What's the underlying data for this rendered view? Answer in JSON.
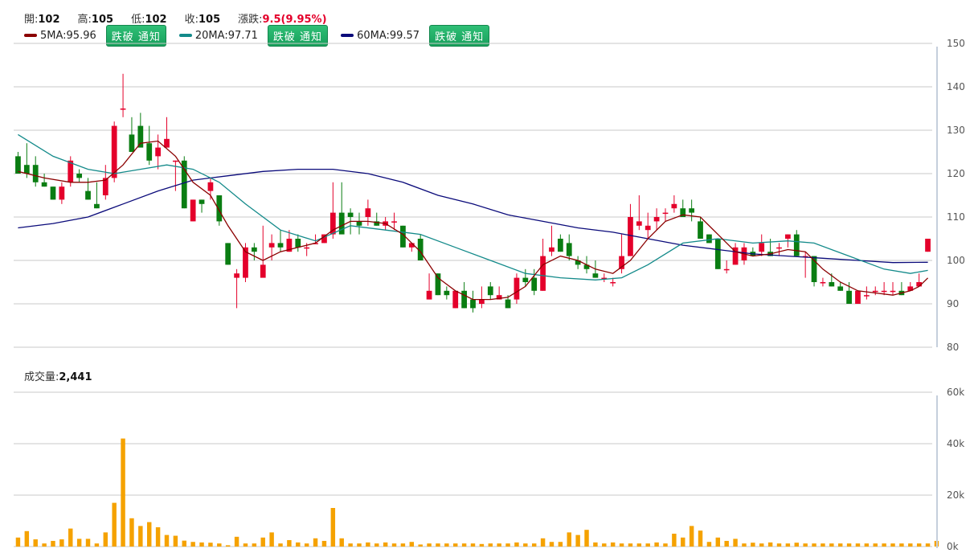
{
  "header": {
    "open_label": "開:",
    "open_value": "102",
    "high_label": "高:",
    "high_value": "105",
    "low_label": "低:",
    "low_value": "102",
    "close_label": "收:",
    "close_value": "105",
    "change_label": "漲跌:",
    "change_value": "9.5(9.95%)"
  },
  "legend": {
    "ma5": "5MA:95.96",
    "ma20": "20MA:97.71",
    "ma60": "60MA:99.57",
    "button_label": "跌破 通知"
  },
  "volume_header": {
    "label": "成交量:",
    "value": "2,441"
  },
  "colors": {
    "up": "#e4002b",
    "down": "#0a7d12",
    "ma5": "#8b0000",
    "ma20": "#138a8a",
    "ma60": "#0a0a7a",
    "volume": "#f5a200",
    "grid": "#c8c8c8"
  },
  "chart_data": [
    {
      "type": "candlestick",
      "ylim": [
        80,
        150
      ],
      "y_ticks": [
        "150",
        "140",
        "130",
        "120",
        "110",
        "100",
        "90",
        "80"
      ],
      "ohlc": [
        [
          124,
          125,
          120,
          120
        ],
        [
          122,
          127,
          119,
          120
        ],
        [
          122,
          124,
          117,
          118
        ],
        [
          118,
          120,
          117,
          117
        ],
        [
          117,
          117,
          114,
          114
        ],
        [
          114,
          118,
          113,
          117
        ],
        [
          118,
          124,
          117,
          123
        ],
        [
          120,
          121,
          118,
          119
        ],
        [
          116,
          119,
          114,
          114
        ],
        [
          113,
          118,
          112,
          112
        ],
        [
          115,
          122,
          114,
          119
        ],
        [
          119,
          132,
          118,
          131
        ],
        [
          135,
          143,
          133,
          135
        ],
        [
          129,
          133,
          125,
          125
        ],
        [
          131,
          134,
          127,
          126
        ],
        [
          127,
          131,
          122,
          123
        ],
        [
          124,
          129,
          121,
          126
        ],
        [
          126,
          133,
          126,
          128
        ],
        [
          123,
          123,
          116,
          123
        ],
        [
          123,
          124,
          112,
          112
        ],
        [
          109,
          114,
          109,
          114
        ],
        [
          114,
          114,
          111,
          113
        ],
        [
          116,
          119,
          114,
          118
        ],
        [
          115,
          115,
          108,
          109
        ],
        [
          104,
          104,
          99,
          99
        ],
        [
          96,
          98,
          89,
          97
        ],
        [
          96,
          104,
          95,
          103
        ],
        [
          103,
          104,
          100,
          102
        ],
        [
          96,
          108,
          98,
          99
        ],
        [
          103,
          106,
          100,
          104
        ],
        [
          104,
          107,
          102,
          103
        ],
        [
          102,
          107,
          102,
          105
        ],
        [
          105,
          106,
          102,
          103
        ],
        [
          103,
          104,
          101,
          103
        ],
        [
          104,
          106,
          104,
          104
        ],
        [
          104,
          106,
          104,
          106
        ],
        [
          106,
          118,
          105,
          111
        ],
        [
          111,
          118,
          108,
          106
        ],
        [
          111,
          112,
          106,
          110
        ],
        [
          109,
          111,
          106,
          108
        ],
        [
          110,
          114,
          108,
          112
        ],
        [
          109,
          111,
          108,
          108
        ],
        [
          108,
          110,
          107,
          109
        ],
        [
          109,
          111,
          107,
          109
        ],
        [
          108,
          108,
          103,
          103
        ],
        [
          103,
          104,
          102,
          104
        ],
        [
          105,
          106,
          100,
          100
        ],
        [
          91,
          97,
          91,
          93
        ],
        [
          97,
          97,
          92,
          92
        ],
        [
          93,
          94,
          91,
          92
        ],
        [
          89,
          93,
          89,
          93
        ],
        [
          93,
          95,
          89,
          89
        ],
        [
          91,
          93,
          88,
          89
        ],
        [
          90,
          94,
          89,
          91
        ],
        [
          94,
          95,
          91,
          92
        ],
        [
          91,
          94,
          91,
          92
        ],
        [
          91,
          92,
          89,
          89
        ],
        [
          91,
          97,
          90,
          96
        ],
        [
          96,
          98,
          94,
          95
        ],
        [
          96,
          98,
          92,
          93
        ],
        [
          93,
          105,
          93,
          101
        ],
        [
          102,
          108,
          101,
          103
        ],
        [
          105,
          106,
          102,
          102
        ],
        [
          104,
          106,
          100,
          101
        ],
        [
          100,
          101,
          98,
          99
        ],
        [
          99,
          101,
          97,
          98
        ],
        [
          97,
          100,
          96,
          96
        ],
        [
          96,
          97,
          95,
          96
        ],
        [
          95,
          96,
          94,
          95
        ],
        [
          98,
          106,
          97,
          101
        ],
        [
          101,
          113,
          101,
          110
        ],
        [
          108,
          115,
          107,
          109
        ],
        [
          107,
          111,
          105,
          108
        ],
        [
          109,
          112,
          107,
          110
        ],
        [
          111,
          112,
          109,
          111
        ],
        [
          112,
          115,
          111,
          113
        ],
        [
          112,
          114,
          110,
          110
        ],
        [
          112,
          114,
          109,
          111
        ],
        [
          109,
          110,
          106,
          105
        ],
        [
          106,
          106,
          104,
          104
        ],
        [
          105,
          105,
          98,
          98
        ],
        [
          98,
          100,
          97,
          98
        ],
        [
          99,
          104,
          99,
          103
        ],
        [
          100,
          104,
          99,
          103
        ],
        [
          102,
          103,
          101,
          101
        ],
        [
          102,
          106,
          101,
          104
        ],
        [
          102,
          105,
          101,
          101
        ],
        [
          103,
          104,
          101,
          103
        ],
        [
          105,
          106,
          103,
          106
        ],
        [
          106,
          107,
          101,
          101
        ],
        [
          101,
          102,
          96,
          101
        ],
        [
          101,
          101,
          94,
          95
        ],
        [
          95,
          96,
          94,
          95
        ],
        [
          95,
          97,
          94,
          94
        ],
        [
          94,
          95,
          93,
          93
        ],
        [
          93,
          95,
          90,
          90
        ],
        [
          90,
          93,
          90,
          93
        ],
        [
          92,
          94,
          91,
          92
        ],
        [
          93,
          94,
          92,
          93
        ],
        [
          93,
          95,
          92,
          93
        ],
        [
          93,
          95,
          92,
          93
        ],
        [
          93,
          95,
          92,
          92
        ],
        [
          93,
          95,
          93,
          94
        ],
        [
          94,
          97,
          94,
          95
        ],
        [
          102,
          105,
          102,
          105
        ]
      ],
      "ma5": [
        [
          0,
          120.5
        ],
        [
          3,
          119
        ],
        [
          6,
          118
        ],
        [
          8,
          118
        ],
        [
          10,
          118.5
        ],
        [
          12,
          122
        ],
        [
          14,
          127
        ],
        [
          16,
          127.5
        ],
        [
          18,
          124
        ],
        [
          20,
          118
        ],
        [
          22,
          115
        ],
        [
          24,
          108
        ],
        [
          26,
          102
        ],
        [
          28,
          100
        ],
        [
          30,
          102
        ],
        [
          32,
          103
        ],
        [
          34,
          104
        ],
        [
          36,
          107
        ],
        [
          38,
          109
        ],
        [
          40,
          109
        ],
        [
          42,
          108.5
        ],
        [
          44,
          106
        ],
        [
          46,
          102
        ],
        [
          48,
          96
        ],
        [
          50,
          93
        ],
        [
          52,
          91
        ],
        [
          54,
          91
        ],
        [
          56,
          91.5
        ],
        [
          58,
          94
        ],
        [
          60,
          99
        ],
        [
          62,
          101
        ],
        [
          64,
          100
        ],
        [
          66,
          98
        ],
        [
          68,
          97
        ],
        [
          70,
          100
        ],
        [
          72,
          105
        ],
        [
          74,
          109
        ],
        [
          76,
          110.5
        ],
        [
          78,
          110
        ],
        [
          80,
          106
        ],
        [
          82,
          102
        ],
        [
          84,
          101
        ],
        [
          86,
          101.5
        ],
        [
          88,
          102.5
        ],
        [
          90,
          102
        ],
        [
          92,
          98
        ],
        [
          94,
          95
        ],
        [
          96,
          93
        ],
        [
          98,
          92.5
        ],
        [
          100,
          92
        ],
        [
          102,
          93
        ],
        [
          103,
          94
        ],
        [
          104,
          95.96
        ]
      ],
      "ma20": [
        [
          0,
          129
        ],
        [
          4,
          124
        ],
        [
          8,
          121
        ],
        [
          11,
          120
        ],
        [
          14,
          121
        ],
        [
          17,
          122
        ],
        [
          20,
          121
        ],
        [
          23,
          118
        ],
        [
          26,
          113
        ],
        [
          30,
          107
        ],
        [
          34,
          104.5
        ],
        [
          38,
          108
        ],
        [
          42,
          107
        ],
        [
          46,
          106
        ],
        [
          50,
          103
        ],
        [
          54,
          100
        ],
        [
          58,
          97
        ],
        [
          62,
          96
        ],
        [
          66,
          95.5
        ],
        [
          69,
          96
        ],
        [
          72,
          99
        ],
        [
          76,
          104
        ],
        [
          80,
          105
        ],
        [
          84,
          104
        ],
        [
          88,
          104.5
        ],
        [
          91,
          104
        ],
        [
          95,
          101
        ],
        [
          99,
          98
        ],
        [
          102,
          97
        ],
        [
          104,
          97.71
        ]
      ],
      "ma60": [
        [
          0,
          107.5
        ],
        [
          4,
          108.5
        ],
        [
          8,
          110
        ],
        [
          12,
          113
        ],
        [
          16,
          116
        ],
        [
          20,
          118.5
        ],
        [
          24,
          119.5
        ],
        [
          28,
          120.5
        ],
        [
          32,
          121
        ],
        [
          36,
          121
        ],
        [
          40,
          120
        ],
        [
          44,
          118
        ],
        [
          48,
          115
        ],
        [
          52,
          113
        ],
        [
          56,
          110.5
        ],
        [
          60,
          109
        ],
        [
          64,
          107.5
        ],
        [
          68,
          106.5
        ],
        [
          72,
          105
        ],
        [
          76,
          103.5
        ],
        [
          80,
          102.5
        ],
        [
          84,
          101.5
        ],
        [
          88,
          101
        ],
        [
          92,
          100.5
        ],
        [
          96,
          100
        ],
        [
          100,
          99.5
        ],
        [
          104,
          99.57
        ]
      ]
    },
    {
      "type": "bar",
      "title": "成交量",
      "ylim": [
        0,
        60
      ],
      "y_ticks": [
        "60k",
        "40k",
        "20k",
        "0k"
      ],
      "values": [
        3.5,
        6,
        2.8,
        1.2,
        2.2,
        2.8,
        7,
        3,
        3,
        1.2,
        5.5,
        17,
        42,
        11,
        8,
        9.5,
        7.5,
        4.5,
        4.2,
        2.3,
        1.8,
        1.6,
        1.5,
        1.2,
        0.5,
        3.8,
        1.2,
        1.2,
        3.5,
        5.5,
        1.2,
        2.5,
        1.6,
        1.2,
        3.2,
        2.2,
        15,
        3.2,
        1.2,
        1.2,
        1.6,
        1.2,
        1.6,
        1.2,
        1.2,
        1.8,
        0.8,
        1.2,
        1.2,
        1.2,
        1.2,
        1.2,
        1.2,
        1,
        1.2,
        1.2,
        1.2,
        1.6,
        1.2,
        1.2,
        3.2,
        1.8,
        1.8,
        5.5,
        4.5,
        6.5,
        1.6,
        1.2,
        1.6,
        1.2,
        1.2,
        1.2,
        1.2,
        1.6,
        1.2,
        5,
        3.5,
        8,
        6.2,
        1.8,
        3.5,
        2.2,
        3,
        1.2,
        1.5,
        1.2,
        1.6,
        1.2,
        1.2,
        1.5,
        1.2,
        1.2,
        1.2,
        1.2,
        1.2,
        1.2,
        1.2,
        1.2,
        1.2,
        1.2,
        1.2,
        1.2,
        1.2,
        1.2,
        1.2,
        2.2
      ]
    }
  ]
}
